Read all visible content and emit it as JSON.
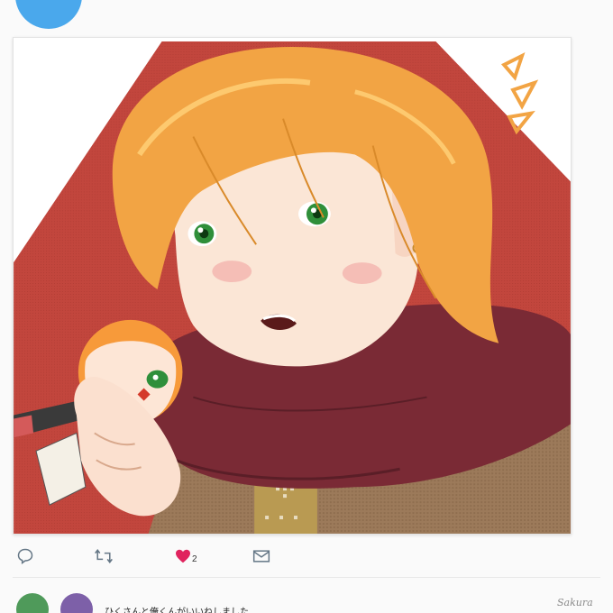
{
  "post": {
    "image_alt": "Illustration of an orange-haired character in a maroon scarf holding a small plush keychain"
  },
  "actions": {
    "reply_icon": "reply-icon",
    "retweet_icon": "retweet-icon",
    "like_icon": "heart-icon",
    "like_count": "2",
    "like_color": "#e0245e",
    "dm_icon": "mail-icon"
  },
  "notification": {
    "text": "ひくさんと俺くんがいいねしました"
  },
  "signature": "Sakura",
  "colors": {
    "accent": "#4aa8ec",
    "icon": "#657786",
    "background": "#fafafa",
    "card_bg": "#c9463e"
  }
}
